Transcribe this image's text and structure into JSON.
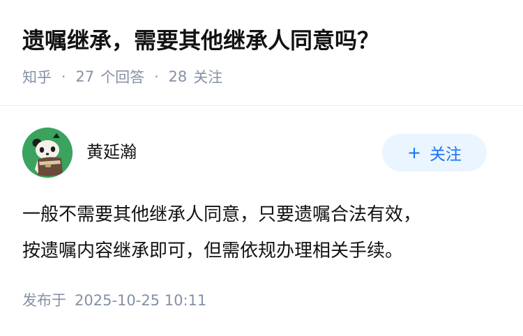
{
  "question": {
    "title": "遗嘱继承，需要其他继承人同意吗？",
    "source": "知乎",
    "answer_count": "27",
    "answer_label": "个回答",
    "follower_count": "28",
    "follower_label": "关注"
  },
  "answer": {
    "author": {
      "name": "黄延瀚",
      "avatar_icon": "panda-avatar-icon"
    },
    "follow_button": {
      "icon": "plus-icon",
      "label": "关注"
    },
    "content_lines": [
      "一般不需要其他继承人同意，只要遗嘱合法有效，",
      "按遗嘱内容继承即可，但需依规办理相关手续。"
    ],
    "publish_label": "发布于",
    "publish_time": "2025-10-25 10:11"
  },
  "colors": {
    "meta_text": "#8590a6",
    "accent": "#1772f6",
    "follow_bg": "#ebf5ff",
    "avatar_bg": "#3aa35d"
  }
}
